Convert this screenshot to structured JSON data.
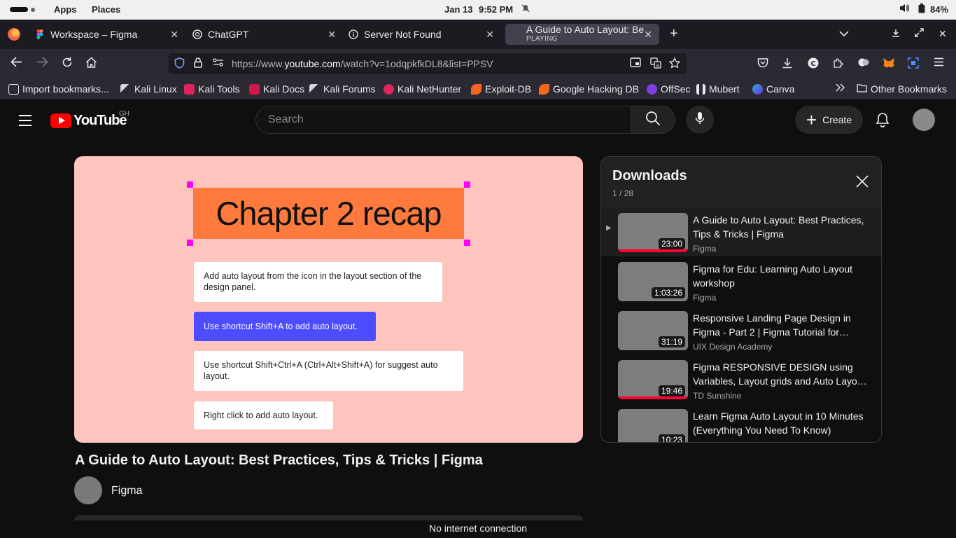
{
  "system_bar": {
    "apps": "Apps",
    "places": "Places",
    "date": "Jan 13",
    "time": "9:52 PM",
    "battery": "84%"
  },
  "tabs": [
    {
      "title": "Workspace – Figma"
    },
    {
      "title": "ChatGPT"
    },
    {
      "title": "Server Not Found"
    },
    {
      "title": "A Guide to Auto Layout: Be",
      "status": "PLAYING"
    }
  ],
  "address_bar": {
    "prefix": "https://www.",
    "domain": "youtube.com",
    "suffix": "/watch?v=1odqpkfkDL8&list=PPSV"
  },
  "bookmarks": [
    {
      "label": "Import bookmarks...",
      "color": "#e9e9ee"
    },
    {
      "label": "Kali Linux",
      "color": "#cfd8e3"
    },
    {
      "label": "Kali Tools",
      "color": "#e0245e"
    },
    {
      "label": "Kali Docs",
      "color": "#e0245e"
    },
    {
      "label": "Kali Forums",
      "color": "#cfd8e3"
    },
    {
      "label": "Kali NetHunter",
      "color": "#e0245e"
    },
    {
      "label": "Exploit-DB",
      "color": "#f5661f"
    },
    {
      "label": "Google Hacking DB",
      "color": "#f5661f"
    },
    {
      "label": "OffSec",
      "color": "#7f3fe4"
    },
    {
      "label": "Mubert",
      "color": "#e9e9ee"
    },
    {
      "label": "Canva",
      "color": "#19b6d3"
    }
  ],
  "other_bookmarks": "Other Bookmarks",
  "youtube": {
    "logo_text": "YouTube",
    "country": "GH",
    "search_placeholder": "Search",
    "create_label": "Create"
  },
  "video": {
    "slide_heading": "Chapter 2 recap",
    "cards": [
      "Add auto layout from the icon in the layout section of the design panel.",
      "Use shortcut Shift+A to add auto layout.",
      "Use shortcut Shift+Ctrl+A (Ctrl+Alt+Shift+A) for suggest auto layout.",
      "Right click to add auto layout."
    ],
    "title": "A Guide to Auto Layout: Best Practices, Tips & Tricks | Figma",
    "channel": "Figma"
  },
  "playlist": {
    "title": "Downloads",
    "count": "1 / 28",
    "items": [
      {
        "title": "A Guide to Auto Layout: Best Practices, Tips & Tricks | Figma",
        "channel": "Figma",
        "duration": "23:00",
        "progress": 1.0
      },
      {
        "title": "Figma for Edu: Learning Auto Layout workshop",
        "channel": "Figma",
        "duration": "1:03:26",
        "progress": 0
      },
      {
        "title": "Responsive Landing Page Design in Figma - Part 2 | Figma Tutorial for…",
        "channel": "UIX Design Academy",
        "duration": "31:19",
        "progress": 0
      },
      {
        "title": "Figma RESPONSIVE DESIGN using Variables, Layout grids and Auto Layo…",
        "channel": "TD Sunshine",
        "duration": "19:46",
        "progress": 1.0
      },
      {
        "title": "Learn Figma Auto Layout in 10 Minutes (Everything You Need To Know)",
        "channel": "",
        "duration": "10:23",
        "progress": 0
      }
    ]
  },
  "status_message": "No internet connection"
}
